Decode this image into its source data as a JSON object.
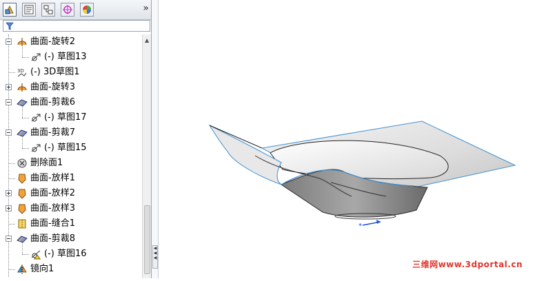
{
  "toolbar": {
    "tabs": [
      {
        "name": "feature-manager"
      },
      {
        "name": "property-manager"
      },
      {
        "name": "configuration-manager"
      },
      {
        "name": "dimxpert-manager"
      },
      {
        "name": "display-manager"
      }
    ],
    "more_label": "»"
  },
  "tree": {
    "items": [
      {
        "label": "曲面-旋转2",
        "icon": "revolve-surface-icon",
        "expander": "expanded",
        "level": 0
      },
      {
        "label": "(-) 草图13",
        "icon": "sketch-icon",
        "expander": "none",
        "level": 1
      },
      {
        "label": "(-) 3D草图1",
        "icon": "3d-sketch-icon",
        "expander": "none",
        "level": 0
      },
      {
        "label": "曲面-旋转3",
        "icon": "revolve-surface-icon",
        "expander": "collapsed",
        "level": 0
      },
      {
        "label": "曲面-剪裁6",
        "icon": "trim-surface-icon",
        "expander": "expanded",
        "level": 0
      },
      {
        "label": "(-) 草图17",
        "icon": "sketch-icon",
        "expander": "none",
        "level": 1
      },
      {
        "label": "曲面-剪裁7",
        "icon": "trim-surface-icon",
        "expander": "expanded",
        "level": 0
      },
      {
        "label": "(-) 草图15",
        "icon": "sketch-icon",
        "expander": "none",
        "level": 1
      },
      {
        "label": "删除面1",
        "icon": "delete-face-icon",
        "expander": "none",
        "level": 0
      },
      {
        "label": "曲面-放样1",
        "icon": "loft-surface-icon",
        "expander": "none",
        "level": 0
      },
      {
        "label": "曲面-放样2",
        "icon": "loft-surface-icon",
        "expander": "collapsed",
        "level": 0
      },
      {
        "label": "曲面-放样3",
        "icon": "loft-surface-icon",
        "expander": "collapsed",
        "level": 0
      },
      {
        "label": "曲面-缝合1",
        "icon": "knit-surface-icon",
        "expander": "none",
        "level": 0
      },
      {
        "label": "曲面-剪裁8",
        "icon": "trim-surface-icon",
        "expander": "expanded",
        "level": 0
      },
      {
        "label": "(-) 草图16",
        "icon": "sketch-warning-icon",
        "expander": "none",
        "level": 1
      },
      {
        "label": "镜向1",
        "icon": "mirror-icon",
        "expander": "none",
        "level": 0
      }
    ]
  },
  "watermark": "三维网www.3dportal.cn",
  "colors": {
    "edge_blue": "#3e8fcf",
    "surface_gray": "#d8d8d8",
    "watermark_red": "#e0362c"
  }
}
